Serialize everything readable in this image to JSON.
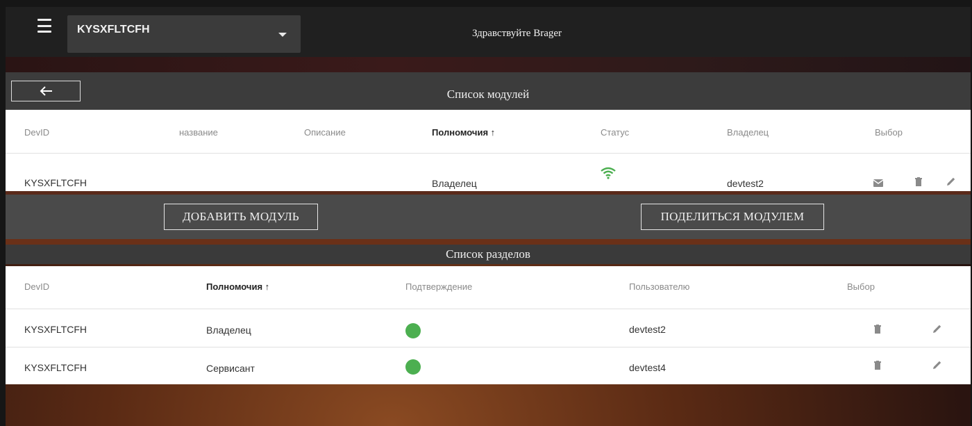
{
  "topbar": {
    "selected_module": "KYSXFLTCFH",
    "greeting": "Здравствуйте Brager"
  },
  "modules": {
    "back_label": "←",
    "title": "Список модулей",
    "columns": [
      "DevID",
      "название",
      "Описание",
      "Полномочия ↑",
      "Статус",
      "Владелец",
      "Выбор"
    ],
    "rows": [
      {
        "devid": "KYSXFLTCFH",
        "name": "",
        "description": "",
        "role": "Владелец",
        "status": "online",
        "owner": "devtest2"
      }
    ],
    "add_button": "ДОБАВИТЬ МОДУЛЬ",
    "share_button": "ПОДЕЛИТЬСЯ МОДУЛЕМ"
  },
  "sections": {
    "title": "Список разделов",
    "columns": [
      "DevID",
      "Полномочия ↑",
      "Подтверждение",
      "Пользователю",
      "Выбор"
    ],
    "rows": [
      {
        "devid": "KYSXFLTCFH",
        "role": "Владелец",
        "confirmed": true,
        "user": "devtest2"
      },
      {
        "devid": "KYSXFLTCFH",
        "role": "Сервисант",
        "confirmed": true,
        "user": "devtest4"
      }
    ]
  },
  "colors": {
    "wifi_green": "#4caf50",
    "confirm_green": "#4caf50",
    "icon_gray": "#8a8a8a"
  },
  "icons": [
    "menu-icon",
    "chevron-down-icon",
    "arrow-left-icon",
    "wifi-icon",
    "mail-icon",
    "trash-icon",
    "pencil-icon"
  ]
}
